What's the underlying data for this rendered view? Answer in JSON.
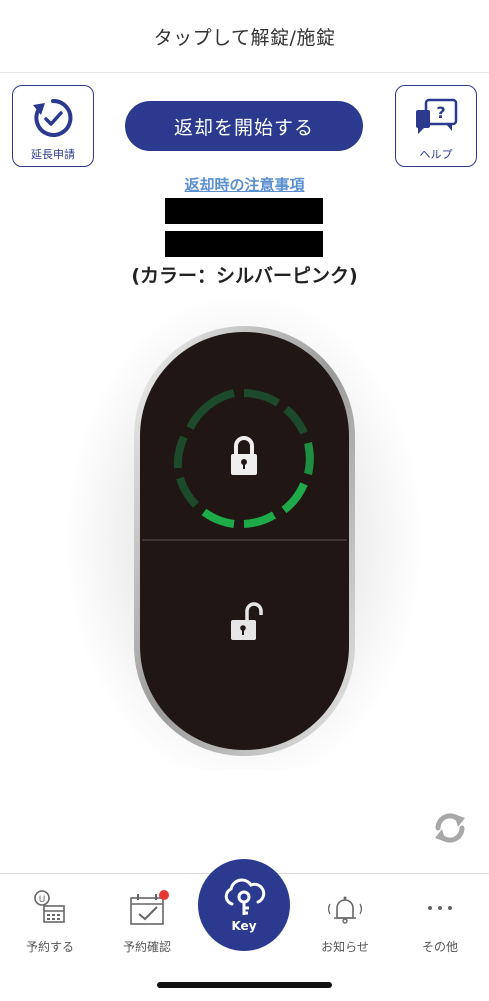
{
  "header": {
    "title": "タップして解錠/施錠"
  },
  "extend_button": {
    "label": "延長申請",
    "icon": "clock-refresh-check-icon"
  },
  "start_return_button": {
    "label": "返却を開始する"
  },
  "help_button": {
    "label": "ヘルプ",
    "icon": "help-chat-icon"
  },
  "notice_link": {
    "label": "返却時の注意事項"
  },
  "vehicle": {
    "color_text": "(カラー：シルバーピンク)"
  },
  "lock_panel": {
    "state": "locked",
    "lock_icon": "lock-closed-icon",
    "unlock_icon": "lock-open-icon",
    "ring_color": "#1faa4a"
  },
  "sync_icon": "sync-icon",
  "tabs": [
    {
      "label": "予約する",
      "icon": "reserve-calendar-icon"
    },
    {
      "label": "予約確認",
      "icon": "calendar-check-icon",
      "badge": true
    },
    {
      "label": "Key",
      "icon": "cloud-key-icon",
      "active": true
    },
    {
      "label": "お知らせ",
      "icon": "bell-icon"
    },
    {
      "label": "その他",
      "icon": "more-dots-icon"
    }
  ],
  "colors": {
    "brand": "#2b3a8f",
    "link": "#5a8fd0",
    "badge": "#e53935"
  }
}
